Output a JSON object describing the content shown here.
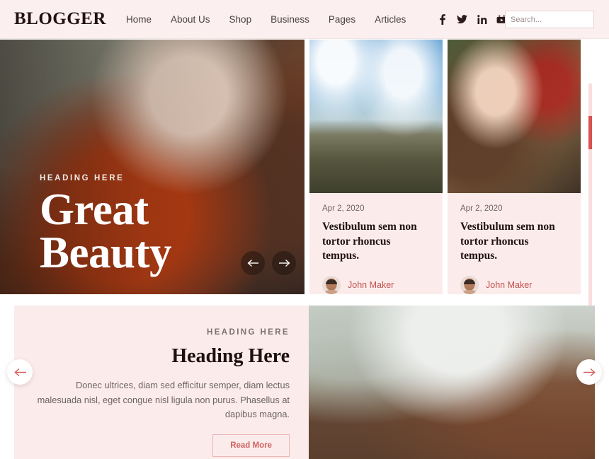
{
  "header": {
    "logo": "BLOGGER",
    "nav": [
      {
        "label": "Home"
      },
      {
        "label": "About Us"
      },
      {
        "label": "Shop"
      },
      {
        "label": "Business"
      },
      {
        "label": "Pages"
      },
      {
        "label": "Articles"
      }
    ],
    "socials": [
      {
        "name": "facebook-icon"
      },
      {
        "name": "twitter-icon"
      },
      {
        "name": "linkedin-icon"
      },
      {
        "name": "youtube-icon"
      },
      {
        "name": "instagram-icon"
      }
    ],
    "search": {
      "placeholder": "Search...",
      "value": "",
      "button_icon": "search-icon",
      "button_color": "#d8504f"
    }
  },
  "hero": {
    "kicker": "HEADING HERE",
    "title_line1": "Great",
    "title_line2": "Beauty",
    "prev_label": "←",
    "next_label": "→"
  },
  "cards": [
    {
      "date": "Apr 2, 2020",
      "title": "Vestibulum sem non tortor rhoncus tempus.",
      "author": "John Maker",
      "image": "hikers-on-mountain-photo"
    },
    {
      "date": "Apr 2, 2020",
      "title": "Vestibulum sem non tortor rhoncus tempus.",
      "author": "John Maker",
      "image": "woman-portrait-berries-photo"
    }
  ],
  "promo": {
    "kicker": "HEADING HERE",
    "title": "Heading Here",
    "paragraph": "Donec ultrices, diam sed efficitur semper, diam lectus malesuada nisl, eget congue nisl ligula non purus. Phasellus at dapibus magna.",
    "button": "Read More",
    "image": "geyser-boardwalk-photo"
  },
  "carousel": {
    "prev_label": "←",
    "next_label": "→"
  },
  "scrollbar": {
    "track_color": "#fadede",
    "thumb_color": "#d9504f"
  },
  "colors": {
    "accent": "#d8504f",
    "pink_bg": "#fbeceb",
    "header_bg": "#fcefef",
    "link": "#c2504e"
  }
}
